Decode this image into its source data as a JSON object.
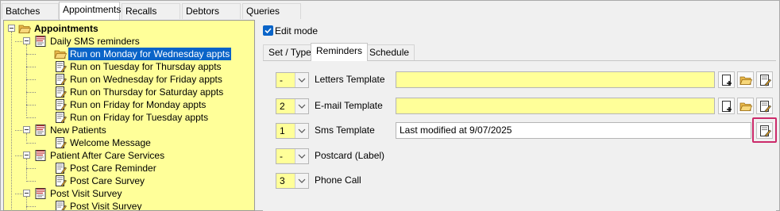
{
  "top_tabs": [
    {
      "label": "Batches",
      "active": false
    },
    {
      "label": "Appointments",
      "active": true
    },
    {
      "label": "Recalls",
      "active": false
    },
    {
      "label": "Debtors",
      "active": false
    },
    {
      "label": "Queries",
      "active": false
    }
  ],
  "tree": {
    "root": "Appointments",
    "groups": [
      {
        "label": "Daily SMS reminders",
        "children": [
          {
            "label": "Run on Monday for Wednesday appts",
            "selected": true
          },
          {
            "label": "Run on Tuesday for Thursday appts"
          },
          {
            "label": "Run on Wednesday for Friday appts"
          },
          {
            "label": "Run on Thursday for Saturday appts"
          },
          {
            "label": "Run on Friday for Monday appts"
          },
          {
            "label": "Run on Friday for Tuesday appts"
          }
        ]
      },
      {
        "label": "New Patients",
        "children": [
          {
            "label": "Welcome Message"
          }
        ]
      },
      {
        "label": "Patient After Care Services",
        "children": [
          {
            "label": "Post Care Reminder"
          },
          {
            "label": "Post Care Survey"
          }
        ]
      },
      {
        "label": "Post Visit Survey",
        "children": [
          {
            "label": "Post Visit Survey"
          }
        ]
      }
    ]
  },
  "edit_mode": {
    "label": "Edit mode",
    "checked": true
  },
  "sub_tabs": [
    {
      "label": "Set / Type",
      "active": false
    },
    {
      "label": "Reminders",
      "active": true
    },
    {
      "label": "Schedule",
      "active": false
    }
  ],
  "reminders": [
    {
      "order": "-",
      "label": "Letters Template",
      "value": "",
      "buttons": [
        "new-doc-icon",
        "open-folder-icon",
        "edit-doc-icon"
      ]
    },
    {
      "order": "2",
      "label": "E-mail Template",
      "value": "",
      "buttons": [
        "new-doc-icon",
        "open-folder-icon",
        "edit-doc-icon"
      ]
    },
    {
      "order": "1",
      "label": "Sms Template",
      "value": "Last modified at 9/07/2025",
      "buttons": [
        "edit-doc-icon"
      ]
    },
    {
      "order": "-",
      "label": "Postcard (Label)"
    },
    {
      "order": "3",
      "label": "Phone Call"
    }
  ],
  "colors": {
    "field_yellow": "#ffff99",
    "selection_blue": "#0a64c8",
    "highlight": "#cc2a6a"
  }
}
